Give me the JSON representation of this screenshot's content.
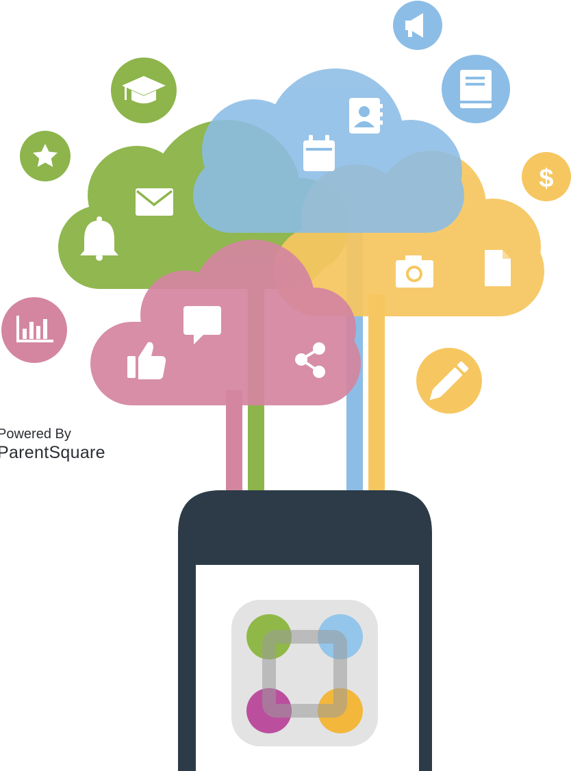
{
  "branding": {
    "powered_label": "Powered By",
    "brand_name": "ParentSquare"
  },
  "colors": {
    "green": "#8db54b",
    "blue": "#8cbde6",
    "yellow": "#f6c760",
    "pink": "#d486a0",
    "phone_body": "#2c3b47",
    "phone_screen": "#ffffff",
    "logo_tile": "#e3e3e3",
    "logo_green": "#8bb53f",
    "logo_blue": "#8ec4ea",
    "logo_magenta": "#b8479a",
    "logo_yellow": "#f2b431"
  },
  "icons": [
    "megaphone-icon",
    "book-icon",
    "graduation-cap-icon",
    "star-icon",
    "dollar-icon",
    "contact-book-icon",
    "calendar-icon",
    "envelope-icon",
    "bell-icon",
    "camera-icon",
    "document-icon",
    "chat-bubble-icon",
    "thumbs-up-icon",
    "share-icon",
    "bar-chart-icon",
    "pencil-icon",
    "parentsquare-logo-icon"
  ]
}
